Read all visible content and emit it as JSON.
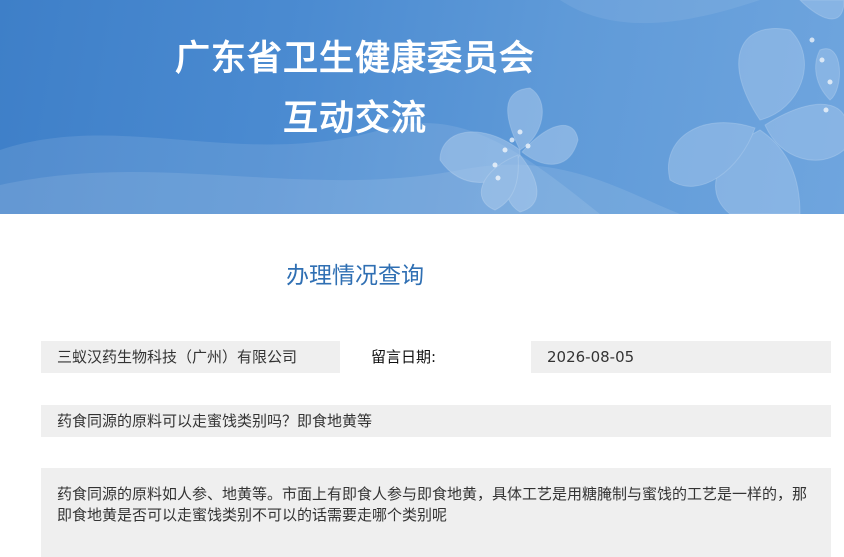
{
  "banner": {
    "title_line1": "广东省卫生健康委员会",
    "title_line2": "互动交流"
  },
  "section": {
    "title": "办理情况查询"
  },
  "record": {
    "company": "三蚁汉药生物科技（广州）有限公司",
    "date_label": "留言日期:",
    "date_value": "2026-08-05",
    "subject": "药食同源的原料可以走蜜饯类别吗？即食地黄等",
    "content": "药食同源的原料如人参、地黄等。市面上有即食人参与即食地黄，具体工艺是用糖腌制与蜜饯的工艺是一样的，那即食地黄是否可以走蜜饯类别不可以的话需要走哪个类别呢"
  },
  "colors": {
    "banner_primary": "#4b8bd1",
    "section_title": "#2f6fb3",
    "cell_background": "#efefef"
  },
  "icons": {
    "banner_decoration": "lily-flower-illustration"
  }
}
